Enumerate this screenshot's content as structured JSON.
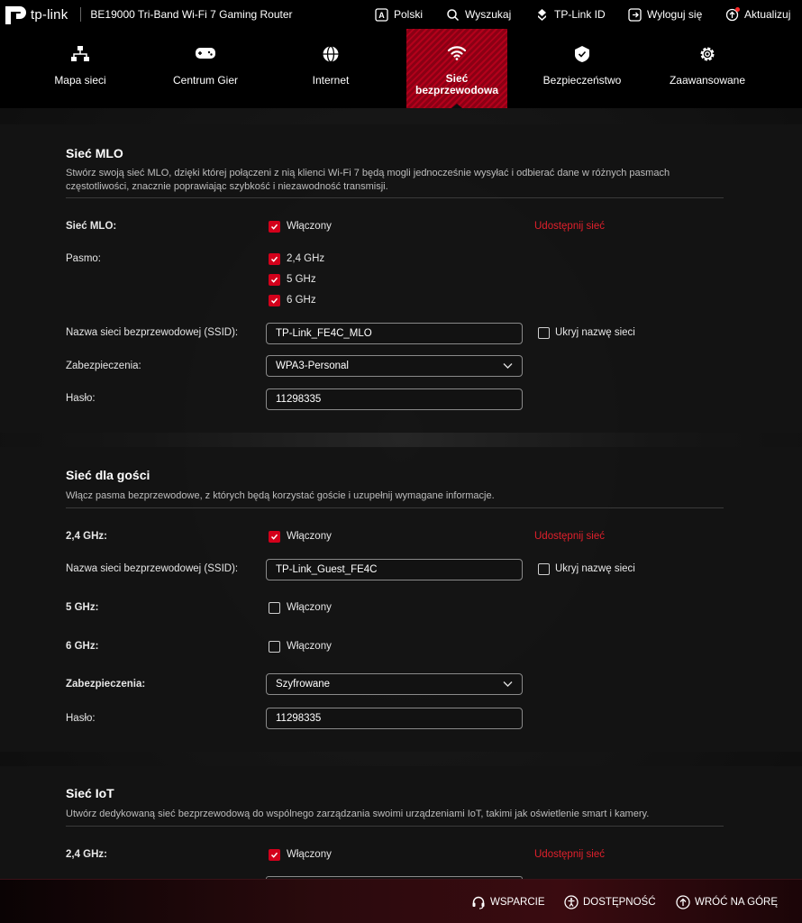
{
  "header": {
    "brand": "tp-link",
    "model": "BE19000 Tri-Band Wi-Fi 7 Gaming Router",
    "actions": [
      {
        "label": "Polski",
        "icon": "language-icon"
      },
      {
        "label": "Wyszukaj",
        "icon": "search-icon"
      },
      {
        "label": "TP-Link ID",
        "icon": "tplink-id-icon"
      },
      {
        "label": "Wyloguj się",
        "icon": "logout-icon"
      },
      {
        "label": "Aktualizuj",
        "icon": "update-icon"
      }
    ]
  },
  "nav": {
    "items": [
      {
        "label": "Mapa sieci",
        "icon": "network-map-icon"
      },
      {
        "label": "Centrum Gier",
        "icon": "gamepad-icon"
      },
      {
        "label": "Internet",
        "icon": "globe-icon"
      },
      {
        "label": "Sieć bezprzewodowa",
        "label_line1": "Sieć",
        "label_line2": "bezprzewodowa",
        "icon": "wifi-icon",
        "active": true
      },
      {
        "label": "Bezpieczeństwo",
        "icon": "shield-icon"
      },
      {
        "label": "Zaawansowane",
        "icon": "gear-icon"
      }
    ]
  },
  "mlo": {
    "title": "Sieć MLO",
    "description": "Stwórz swoją sieć MLO, dzięki której połączeni z nią klienci Wi-Fi 7 będą mogli jednocześnie wysyłać i odbierać dane w różnych pasmach częstotliwości, znacznie poprawiając szybkość i niezawodność transmisji.",
    "enable_label": "Sieć MLO:",
    "enabled_text": "Włączony",
    "enabled": true,
    "share_label": "Udostępnij sieć",
    "band_label": "Pasmo:",
    "bands": [
      {
        "label": "2,4 GHz",
        "checked": true
      },
      {
        "label": "5 GHz",
        "checked": true
      },
      {
        "label": "6 GHz",
        "checked": true
      }
    ],
    "ssid_label": "Nazwa sieci bezprzewodowej (SSID):",
    "ssid_value": "TP-Link_FE4C_MLO",
    "hide_ssid_label": "Ukryj nazwę sieci",
    "hide_ssid": false,
    "security_label": "Zabezpieczenia:",
    "security_value": "WPA3-Personal",
    "password_label": "Hasło:",
    "password_value": "11298335"
  },
  "guest": {
    "title": "Sieć dla gości",
    "description": "Włącz pasma bezprzewodowe, z których będą korzystać goście i uzupełnij wymagane informacje.",
    "band24_label": "2,4 GHz:",
    "band24_enabled_text": "Włączony",
    "band24_enabled": true,
    "share_label": "Udostępnij sieć",
    "ssid_label": "Nazwa sieci bezprzewodowej (SSID):",
    "ssid_value": "TP-Link_Guest_FE4C",
    "hide_ssid_label": "Ukryj nazwę sieci",
    "hide_ssid": false,
    "band5_label": "5 GHz:",
    "band5_enabled_text": "Włączony",
    "band5_enabled": false,
    "band6_label": "6 GHz:",
    "band6_enabled_text": "Włączony",
    "band6_enabled": false,
    "security_label": "Zabezpieczenia:",
    "security_value": "Szyfrowane",
    "password_label": "Hasło:",
    "password_value": "11298335"
  },
  "iot": {
    "title": "Sieć IoT",
    "description": "Utwórz dedykowaną sieć bezprzewodową do wspólnego zarządzania swoimi urządzeniami IoT, takimi jak oświetlenie smart i kamery.",
    "band24_label": "2,4 GHz:",
    "band24_enabled_text": "Włączony",
    "band24_enabled": true,
    "share_label": "Udostępnij sieć"
  },
  "footer": {
    "support": "WSPARCIE",
    "accessibility": "DOSTĘPNOŚĆ",
    "back_to_top": "WRÓĆ NA GÓRĘ"
  },
  "colors": {
    "accent": "#d3001b",
    "link_red": "#e0202c",
    "background": "#0d0d0e"
  }
}
